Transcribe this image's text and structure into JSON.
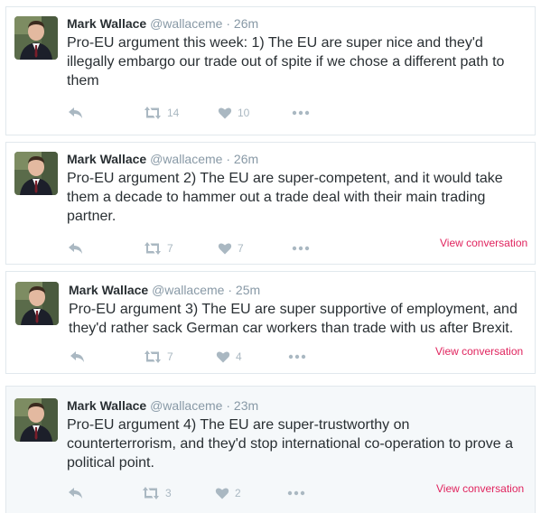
{
  "colors": {
    "name": "#292f33",
    "muted": "#8899a6",
    "action": "#aab8c2",
    "view_conversation": "#e0245e",
    "border": "#e1e8ed"
  },
  "icons": [
    "reply-icon",
    "retweet-icon",
    "heart-icon",
    "more-icon"
  ],
  "tweets": [
    {
      "name": "Mark Wallace",
      "handle": "@wallaceme",
      "separator": "·",
      "time": "26m",
      "lines": [
        "Pro-EU argument this week: 1) The EU are super nice and they'd",
        "illegally embargo our trade out of spite if we chose a different path to",
        "them"
      ],
      "retweets": "14",
      "likes": "10",
      "view_conversation": ""
    },
    {
      "name": "Mark Wallace",
      "handle": "@wallaceme",
      "separator": "·",
      "time": "26m",
      "lines": [
        "Pro-EU argument 2) The EU are super-competent, and it would take",
        "them a decade to hammer out a trade deal with their main trading",
        "partner."
      ],
      "retweets": "7",
      "likes": "7",
      "view_conversation": "View conversation"
    },
    {
      "name": "Mark Wallace",
      "handle": "@wallaceme",
      "separator": "·",
      "time": "25m",
      "lines": [
        "Pro-EU argument 3) The EU are super supportive of employment, and",
        "they'd rather sack German car workers than trade with us after Brexit."
      ],
      "retweets": "7",
      "likes": "4",
      "view_conversation": "View conversation"
    },
    {
      "name": "Mark Wallace",
      "handle": "@wallaceme",
      "separator": "·",
      "time": "23m",
      "lines": [
        "Pro-EU argument 4) The EU are super-trustworthy on",
        "counterterrorism, and they'd stop international co-operation to prove a",
        "political point."
      ],
      "retweets": "3",
      "likes": "2",
      "view_conversation": "View conversation"
    }
  ]
}
